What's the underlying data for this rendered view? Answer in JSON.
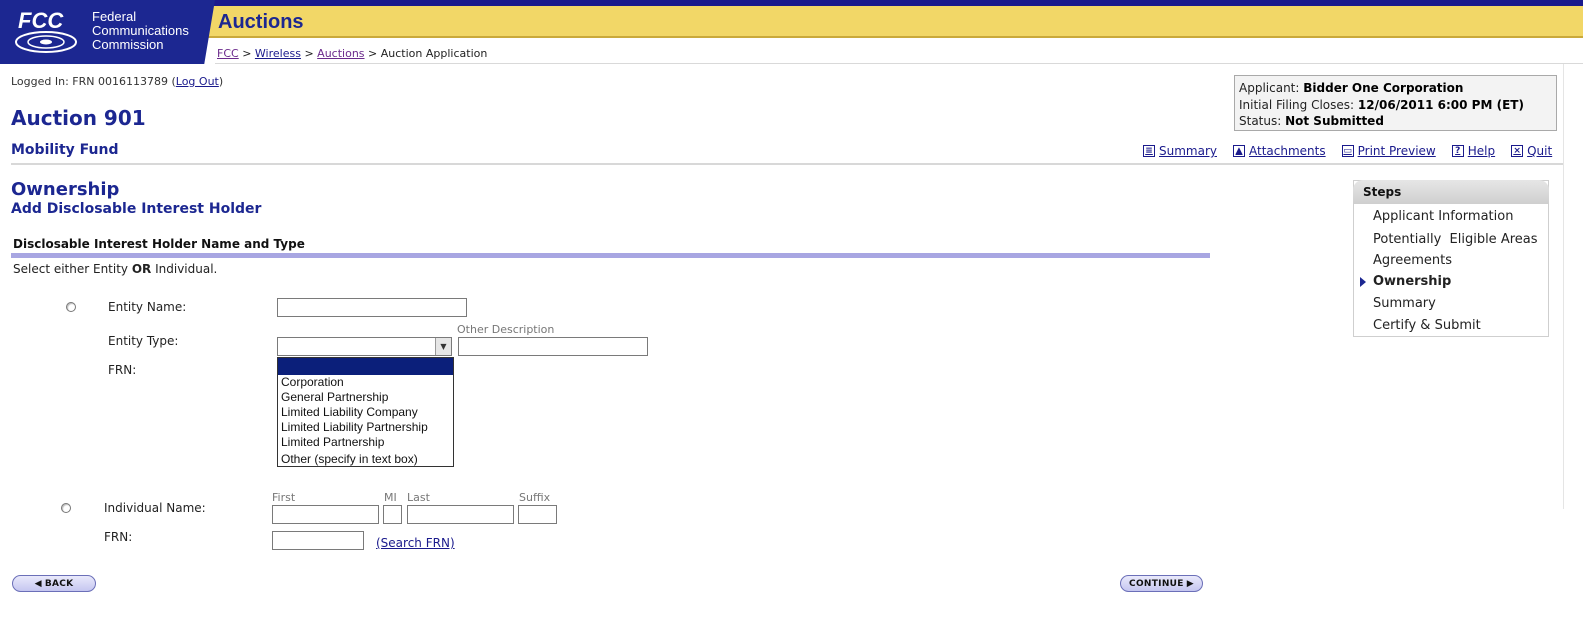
{
  "header": {
    "fcc_logo_text": "FCC",
    "agency_name_lines": [
      "Federal",
      "Communications",
      "Commission"
    ],
    "app_title": "Auctions",
    "breadcrumb": [
      {
        "label": "FCC",
        "link": true
      },
      {
        "label": "Wireless",
        "link": true
      },
      {
        "label": "Auctions",
        "link": true
      },
      {
        "label": "Auction Application",
        "link": false
      }
    ],
    "breadcrumb_separator": ">"
  },
  "login": {
    "prefix": "Logged In: FRN 0016113789 (",
    "logout_label": "Log Out",
    "suffix": ")"
  },
  "auction": {
    "title": "Auction 901",
    "subtitle": "Mobility Fund"
  },
  "info_box": {
    "applicant_label": "Applicant:",
    "applicant_value": "Bidder One Corporation",
    "filing_label": "Initial Filing Closes:",
    "filing_value": "12/06/2011 6:00 PM (ET)",
    "status_label": "Status:",
    "status_value": "Not Submitted"
  },
  "toolbar": [
    {
      "label": "Summary",
      "icon": "summary-icon"
    },
    {
      "label": "Attachments",
      "icon": "attachments-icon"
    },
    {
      "label": "Print Preview",
      "icon": "print-icon"
    },
    {
      "label": "Help",
      "icon": "help-icon"
    },
    {
      "label": "Quit",
      "icon": "quit-icon"
    }
  ],
  "section": {
    "title": "Ownership",
    "subtitle": "Add Disclosable Interest Holder",
    "panel_heading": "Disclosable Interest Holder Name and Type",
    "instruction_pre": "Select either Entity ",
    "instruction_bold": "OR",
    "instruction_post": " Individual."
  },
  "entity": {
    "name_label": "Entity Name:",
    "name_value": "",
    "type_label": "Entity Type:",
    "type_value": "",
    "other_description_label": "Other Description",
    "other_description_value": "",
    "frn_label": "FRN:",
    "type_options": [
      "",
      "Corporation",
      "General Partnership",
      "Limited Liability Company",
      "Limited Liability Partnership",
      "Limited Partnership",
      "Other (specify in text box)"
    ]
  },
  "individual": {
    "name_label": "Individual Name:",
    "first_label": "First",
    "mi_label": "MI",
    "last_label": "Last",
    "suffix_label": "Suffix",
    "frn_label": "FRN:",
    "search_frn_label": "(Search FRN)"
  },
  "buttons": {
    "back": "BACK",
    "continue": "CONTINUE"
  },
  "steps": {
    "heading": "Steps",
    "items": [
      {
        "label": "Applicant Information",
        "current": false
      },
      {
        "label": "Potentially  Eligible Areas",
        "current": false
      },
      {
        "label": "Agreements",
        "current": false
      },
      {
        "label": "Ownership",
        "current": true
      },
      {
        "label": "Summary",
        "current": false
      },
      {
        "label": "Certify & Submit",
        "current": false
      }
    ]
  },
  "colors": {
    "brand_navy": "#1c2791",
    "header_yellow": "#f2d767",
    "panel_rule": "#a8a6e2",
    "selected_option": "#0b1f7a"
  }
}
